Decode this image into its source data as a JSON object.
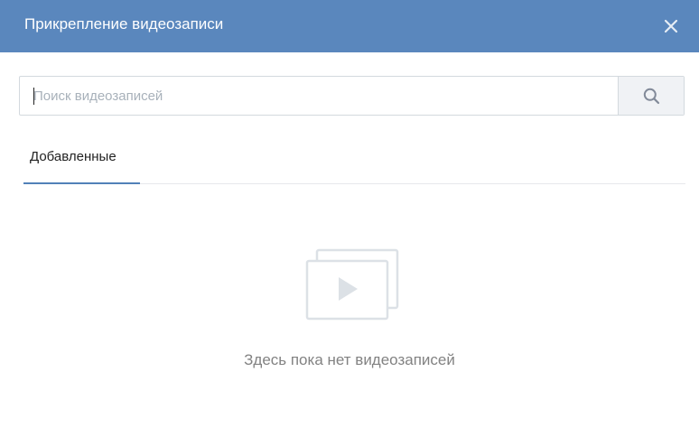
{
  "header": {
    "title": "Прикрепление видеозаписи",
    "close_icon": "close-icon",
    "background_color": "#5a87bd"
  },
  "search": {
    "value": "",
    "placeholder": "Поиск видеозаписей",
    "button_icon": "search-icon"
  },
  "tabs": [
    {
      "label": "Добавленные",
      "active": true
    }
  ],
  "accent_color": "#5181b8",
  "empty_state": {
    "icon": "video-stack-icon",
    "text": "Здесь пока нет видеозаписей"
  }
}
